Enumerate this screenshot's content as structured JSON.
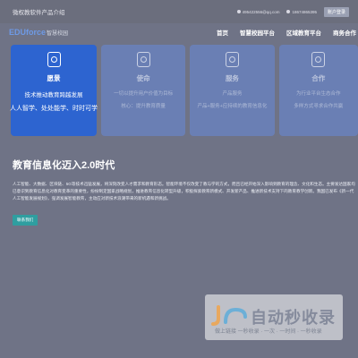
{
  "topbar": {
    "intro": "微权教软件产品介绍",
    "email": "495422556@qq.com",
    "phone": "18674865395",
    "login": "账户登录"
  },
  "nav": {
    "brand": "EDUforce",
    "brand_sub": "智慧校园",
    "menu": [
      "首页",
      "智慧校园平台",
      "区域教育平台",
      "商务合作"
    ]
  },
  "cards": [
    {
      "title": "愿景",
      "line1": "技术推动教育跨越发展",
      "line2": "人人智学、处处能学、时时可学"
    },
    {
      "title": "使命",
      "line1": "一切以提升用户价值为目标",
      "line2": "核心：提升教育质量"
    },
    {
      "title": "服务",
      "line1": "产品服务",
      "line2": "产品+服务+应持续的教育信息化"
    },
    {
      "title": "合作",
      "line1": "为行业平台生态合作",
      "line2": "多样方式寻求合作共赢"
    }
  ],
  "main": {
    "headline": "教育信息化迈入2.0时代",
    "body": "人工智能、大数据、区块链、5G等技术迅猛发展，将深刻改变人才需求和教育形态。智能环境不仅改变了教与学的方式，而且已经开始深入影响到教育的理念、文化和生态。主要发达国家均已意识到教育信息化对教育变革的重要性，纷纷制定国家战略规划，推进教育信息化转型升级，积极探索教育新模式、开发新产品、推进新技术支持下的教育教学创新。我国已发布《新一代人工智能发展规划》，强调发展智能教育，主动应对新技术浪潮带来的新机遇和新挑战。",
    "cta": "联系我们"
  },
  "watermark": {
    "text": "自动秒收录",
    "sub": "做上链接 一秒收录 · 一次 · 一时间 · 一秒收录"
  }
}
